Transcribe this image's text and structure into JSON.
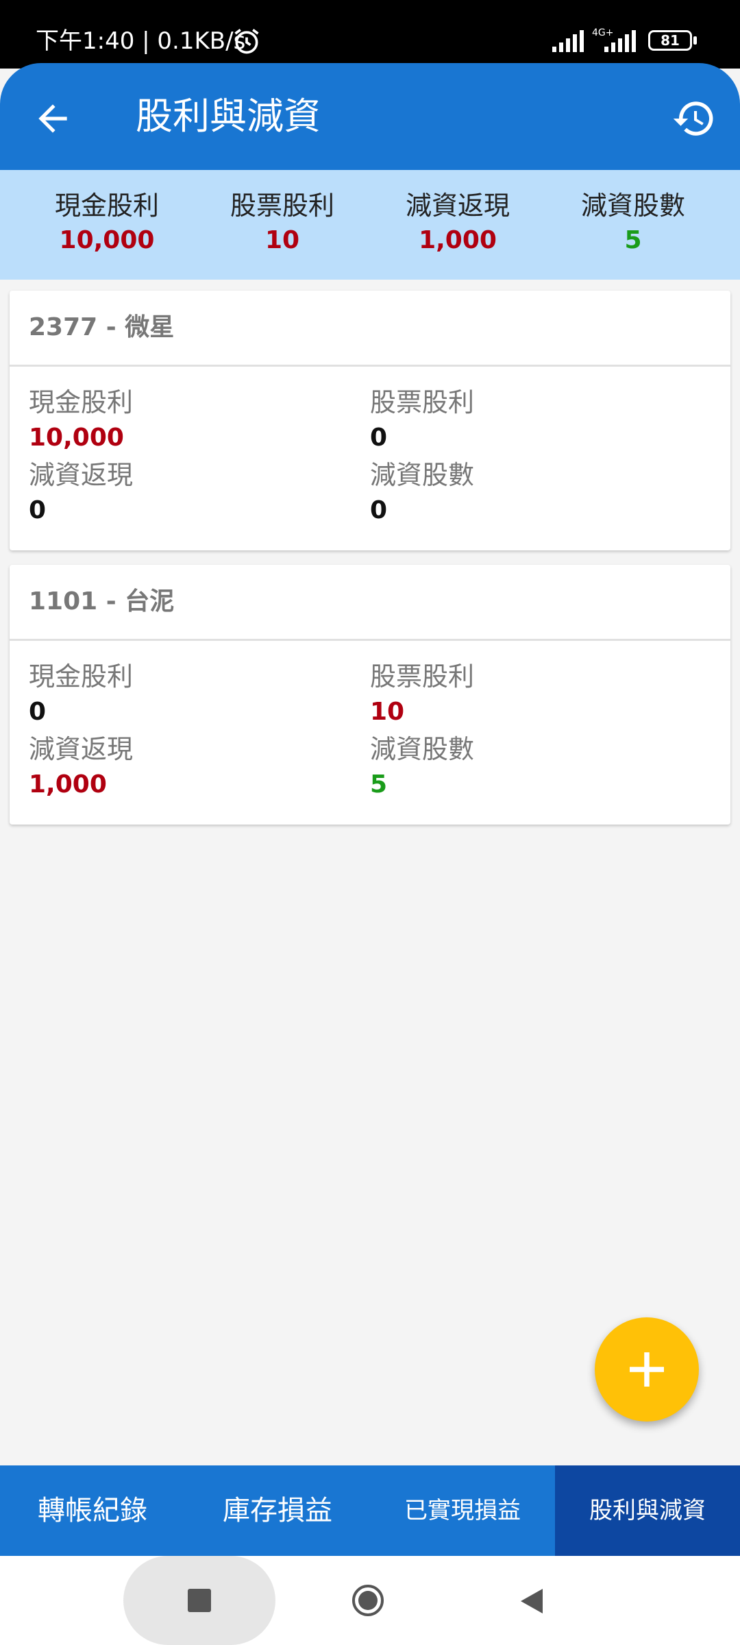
{
  "status_bar": {
    "text": "下午1:40 | 0.1KB/s",
    "network": "4G+",
    "battery": "81"
  },
  "app_bar": {
    "title": "股利與減資"
  },
  "summary": [
    {
      "label": "現金股利",
      "value": "10,000",
      "color": "#b00010"
    },
    {
      "label": "股票股利",
      "value": "10",
      "color": "#b00010"
    },
    {
      "label": "減資返現",
      "value": "1,000",
      "color": "#b00010"
    },
    {
      "label": "減資股數",
      "value": "5",
      "color": "#1a9c1a"
    }
  ],
  "cards": [
    {
      "title": "2377 - 微星",
      "fields": [
        {
          "label": "現金股利",
          "value": "10,000"
        },
        {
          "label": "股票股利",
          "value": "0"
        },
        {
          "label": "減資返現",
          "value": "0"
        },
        {
          "label": "減資股數",
          "value": "0"
        }
      ]
    },
    {
      "title": "1101 - 台泥",
      "fields": [
        {
          "label": "現金股利",
          "value": "0"
        },
        {
          "label": "股票股利",
          "value": "10"
        },
        {
          "label": "減資返現",
          "value": "1,000"
        },
        {
          "label": "減資股數",
          "value": "5"
        }
      ]
    }
  ],
  "fab": {
    "icon": "plus-icon"
  },
  "bottom_nav": [
    {
      "label": "轉帳紀錄"
    },
    {
      "label": "庫存損益"
    },
    {
      "label": "已實現損益"
    },
    {
      "label": "股利與減資",
      "active": true
    }
  ],
  "colors": {
    "primary": "#1976d2",
    "primary_dark": "#0d47a1",
    "summary_bg": "#bbdefb",
    "accent": "#ffc107",
    "positive": "#b00010",
    "negative": "#1a9c1a"
  }
}
